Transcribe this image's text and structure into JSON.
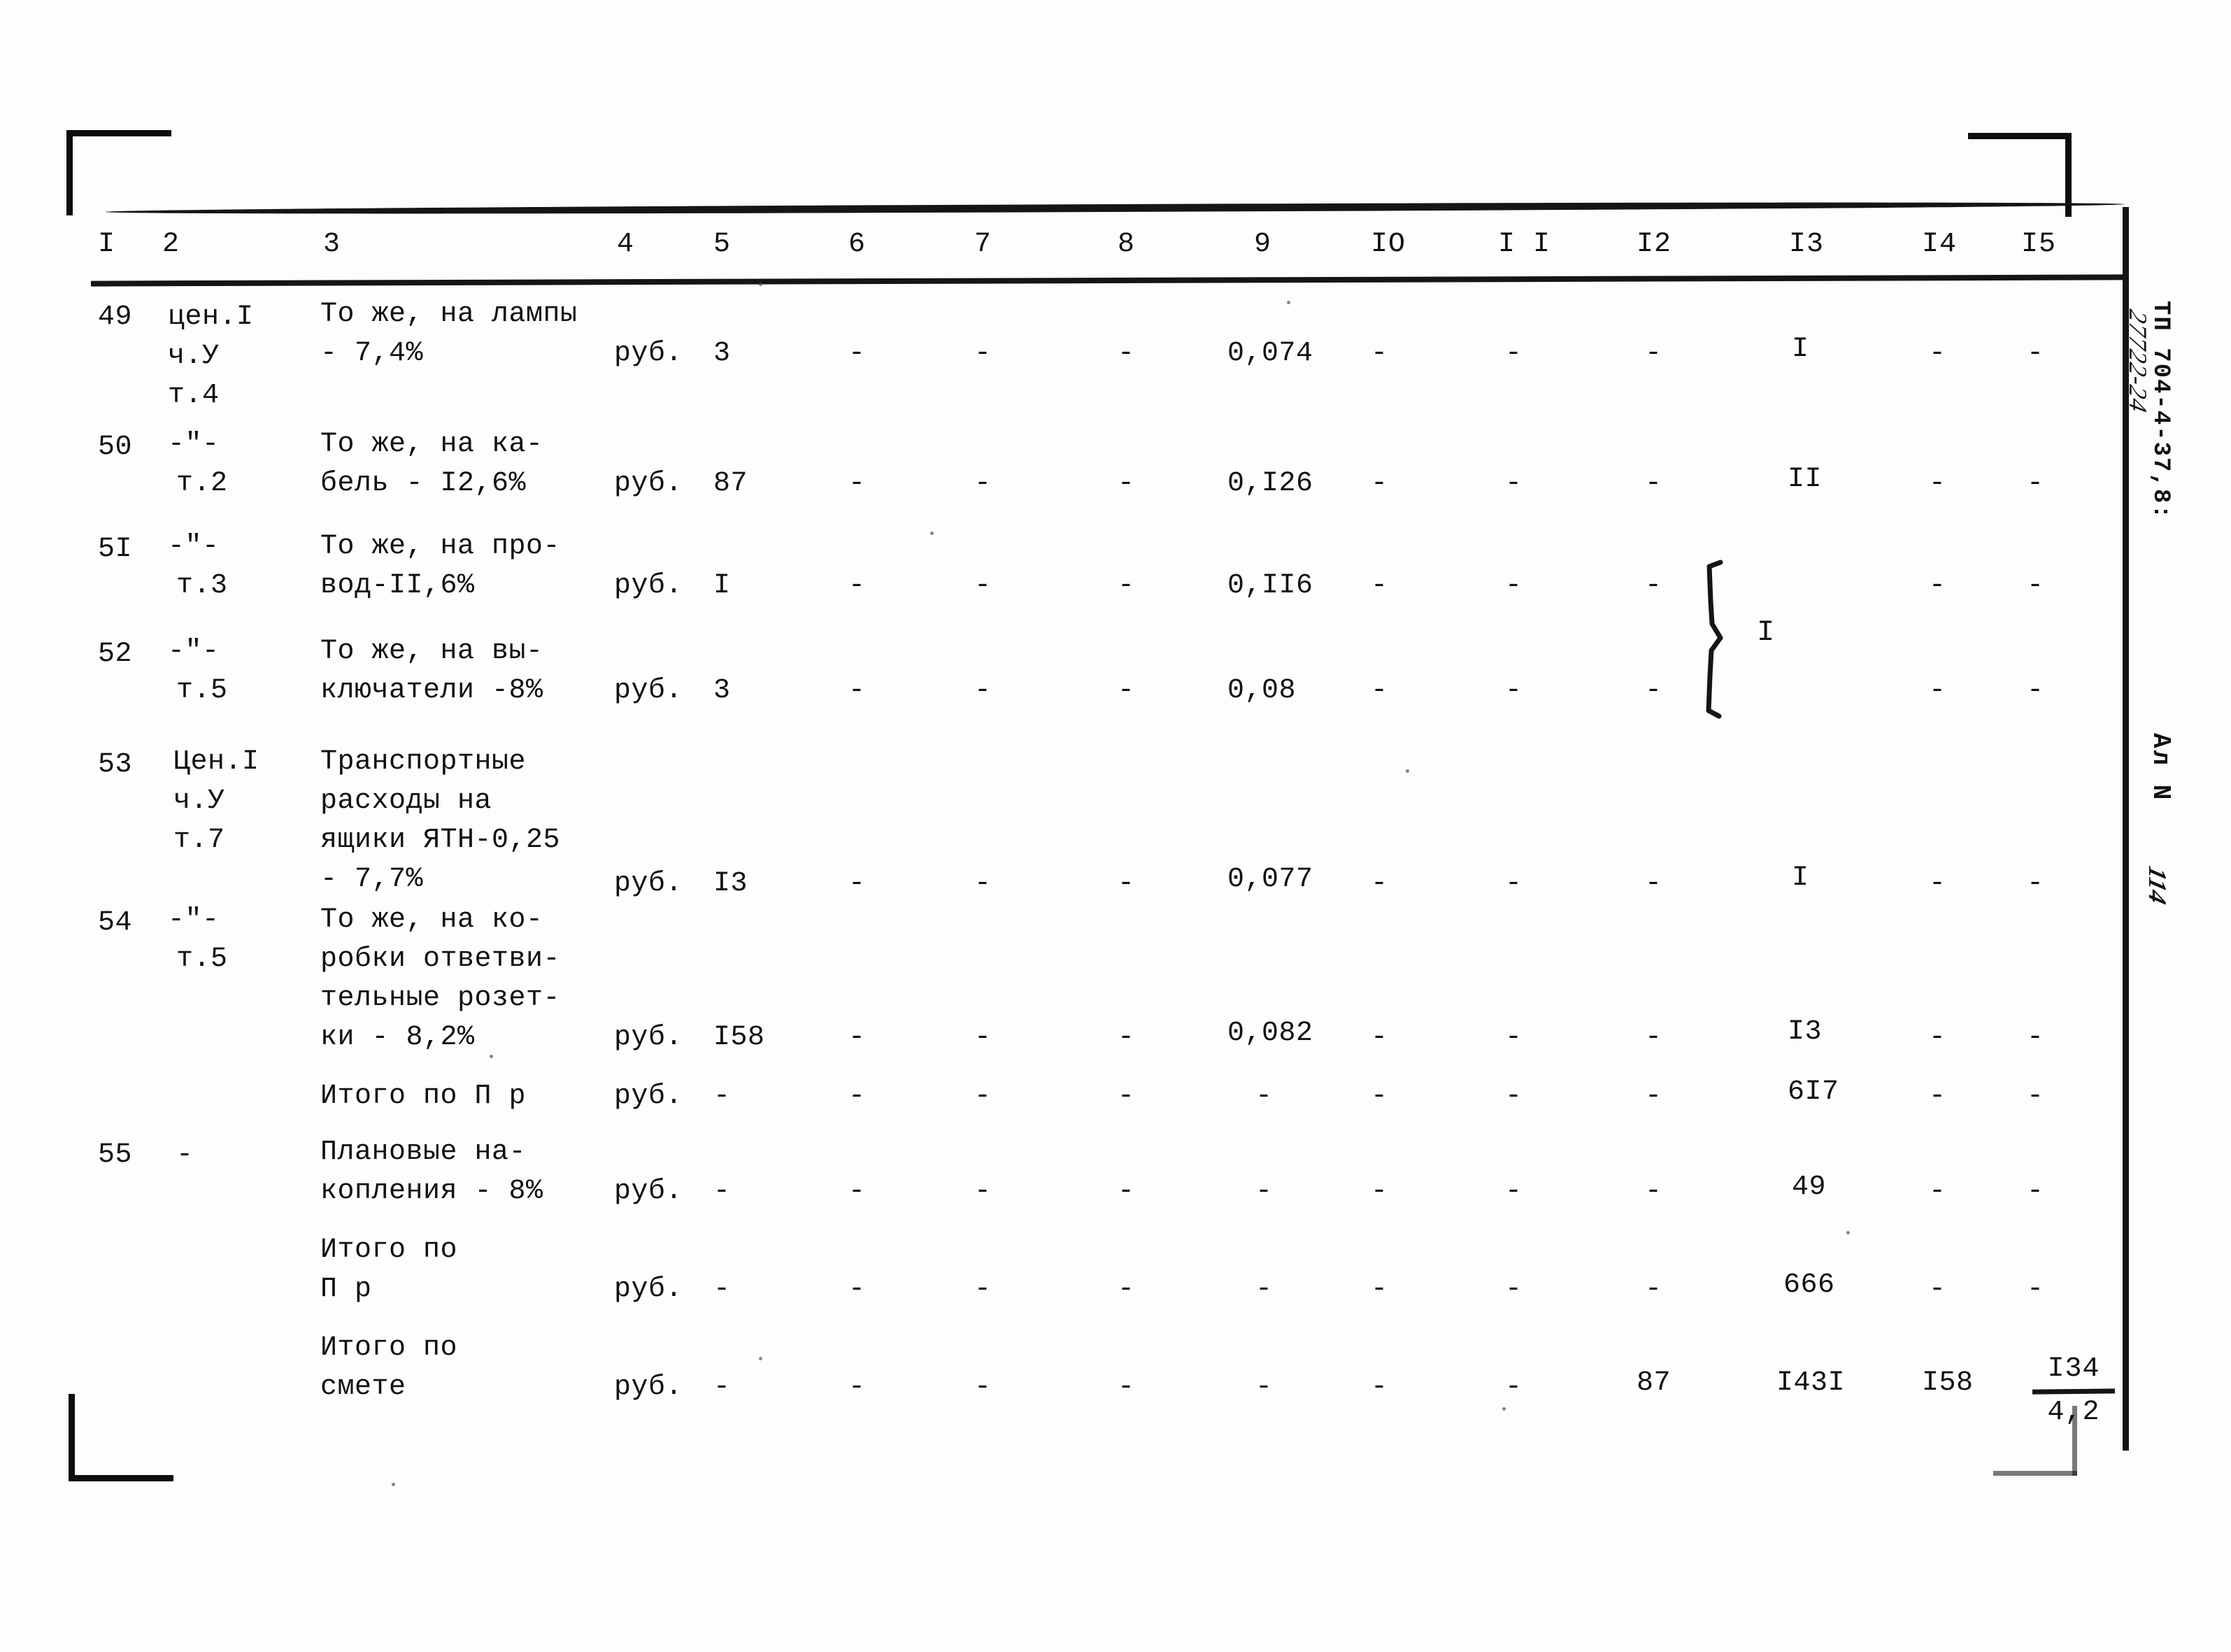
{
  "document": {
    "type": "soviet-estimate-table",
    "margin_notes": {
      "stamp_vertical": "ТП 704-4-37,8:",
      "handwritten_code": "27722-24",
      "album_label": "Ал N",
      "page_number": "114"
    }
  },
  "table": {
    "column_headers": [
      "I",
      "2",
      "3",
      "4",
      "5",
      "6",
      "7",
      "8",
      "9",
      "IO",
      "I I",
      "I2",
      "I3",
      "I4",
      "I5"
    ],
    "rows": [
      {
        "num": "49",
        "ref": [
          "цен.I",
          "ч.У",
          "т.4"
        ],
        "desc": [
          "То же, на лампы",
          "- 7,4%"
        ],
        "unit": "руб.",
        "c5": "3",
        "c6": "-",
        "c7": "-",
        "c8": "-",
        "c9": "0,074",
        "c10": "-",
        "c11": "-",
        "c12": "-",
        "c13": "I",
        "c14": "-",
        "c15": "-"
      },
      {
        "num": "50",
        "ref": [
          "-\"-",
          "т.2"
        ],
        "desc": [
          "То же, на ка-",
          "бель - I2,6%"
        ],
        "unit": "руб.",
        "c5": "87",
        "c6": "-",
        "c7": "-",
        "c8": "-",
        "c9": "0,I26",
        "c10": "-",
        "c11": "-",
        "c12": "-",
        "c13": "II",
        "c14": "-",
        "c15": "-"
      },
      {
        "num": "5I",
        "ref": [
          "-\"-",
          "т.3"
        ],
        "desc": [
          "То же, на про-",
          "вод-II,6%"
        ],
        "unit": "руб.",
        "c5": "I",
        "c6": "-",
        "c7": "-",
        "c8": "-",
        "c9": "0,II6",
        "c10": "-",
        "c11": "-",
        "c12": "-",
        "c13": "",
        "c14": "-",
        "c15": "-"
      },
      {
        "num": "52",
        "ref": [
          "-\"-",
          "т.5"
        ],
        "desc": [
          "То же, на вы-",
          "ключатели -8%"
        ],
        "unit": "руб.",
        "c5": "3",
        "c6": "-",
        "c7": "-",
        "c8": "-",
        "c9": "0,08",
        "c10": "-",
        "c11": "-",
        "c12": "-",
        "c13": "",
        "c14": "-",
        "c15": "-"
      },
      {
        "num": "53",
        "ref": [
          "Цен.I",
          "ч.У",
          "т.7"
        ],
        "desc": [
          "Транспортные",
          "расходы на",
          "ящики ЯТН-0,25",
          "- 7,7%"
        ],
        "unit": "руб.",
        "c5": "I3",
        "c6": "-",
        "c7": "-",
        "c8": "-",
        "c9": "0,077",
        "c10": "-",
        "c11": "-",
        "c12": "-",
        "c13": "I",
        "c14": "-",
        "c15": "-"
      },
      {
        "num": "54",
        "ref": [
          "-\"-",
          "т.5"
        ],
        "desc": [
          "То же, на ко-",
          "робки ответви-",
          "тельные розет-",
          "ки - 8,2%"
        ],
        "unit": "руб.",
        "c5": "I58",
        "c6": "-",
        "c7": "-",
        "c8": "-",
        "c9": "0,082",
        "c10": "-",
        "c11": "-",
        "c12": "-",
        "c13": "I3",
        "c14": "-",
        "c15": "-"
      },
      {
        "num": "",
        "ref": [],
        "desc": [
          "Итого по П р"
        ],
        "unit": "руб.",
        "c5": "-",
        "c6": "-",
        "c7": "-",
        "c8": "-",
        "c9": "-",
        "c10": "-",
        "c11": "-",
        "c12": "-",
        "c13": "6I7",
        "c14": "-",
        "c15": "-"
      },
      {
        "num": "55",
        "ref": [
          "-"
        ],
        "desc": [
          "Плановые на-",
          "копления - 8%"
        ],
        "unit": "руб.",
        "c5": "-",
        "c6": "-",
        "c7": "-",
        "c8": "-",
        "c9": "-",
        "c10": "-",
        "c11": "-",
        "c12": "-",
        "c13": "49",
        "c14": "-",
        "c15": "-"
      },
      {
        "num": "",
        "ref": [],
        "desc": [
          "Итого по",
          "П р"
        ],
        "unit": "руб.",
        "c5": "-",
        "c6": "-",
        "c7": "-",
        "c8": "-",
        "c9": "-",
        "c10": "-",
        "c11": "-",
        "c12": "-",
        "c13": "666",
        "c14": "-",
        "c15": "-"
      },
      {
        "num": "",
        "ref": [],
        "desc": [
          "Итого по",
          "смете"
        ],
        "unit": "руб.",
        "c5": "-",
        "c6": "-",
        "c7": "-",
        "c8": "-",
        "c9": "-",
        "c10": "-",
        "c11": "-",
        "c12": "87",
        "c13": "I43I",
        "c14": "I58",
        "c15": "I34"
      }
    ],
    "brace_group": {
      "label": "I",
      "spans_rows": [
        "5I",
        "52"
      ]
    },
    "final_fraction": {
      "numerator": "I34",
      "denominator": "4,2"
    }
  }
}
